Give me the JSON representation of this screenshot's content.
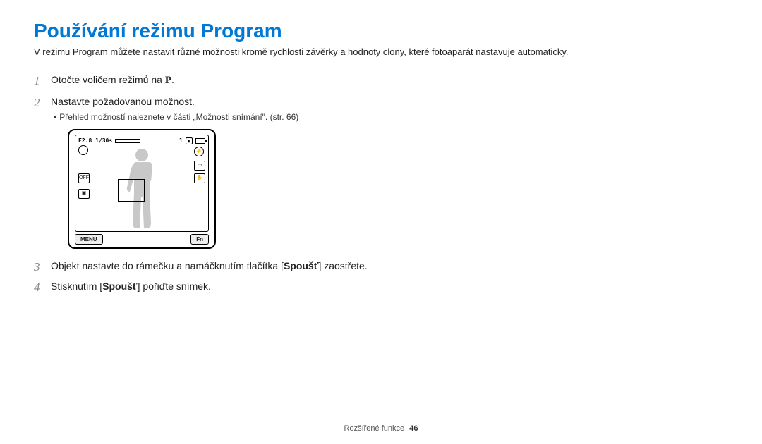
{
  "title": "Používání režimu Program",
  "intro": "V režimu Program můžete nastavit různé možnosti kromě rychlosti závěrky a hodnoty clony, které fotoaparát nastavuje automaticky.",
  "steps": {
    "s1_pre": "Otočte voličem režimů na ",
    "s1_icon": "P",
    "s1_post": ".",
    "s2": "Nastavte požadovanou možnost.",
    "s2_sub": "Přehled možností naleznete v části „Možnosti snímání\". (str. 66)",
    "s3_pre": "Objekt nastavte do rámečku a namáčknutím tlačítka [",
    "s3_bold": "Spoušť",
    "s3_post": "] zaostřete.",
    "s4_pre": "Stisknutím [",
    "s4_bold": "Spoušť",
    "s4_post": "] pořiďte snímek."
  },
  "diagram": {
    "exposure": "F2.8 1/30s",
    "count": "1",
    "menu": "MENU",
    "fn": "Fn",
    "off_label": "OFF"
  },
  "nums": {
    "n1": "1",
    "n2": "2",
    "n3": "3",
    "n4": "4"
  },
  "footer": {
    "section": "Rozšířené funkce",
    "page": "46"
  }
}
